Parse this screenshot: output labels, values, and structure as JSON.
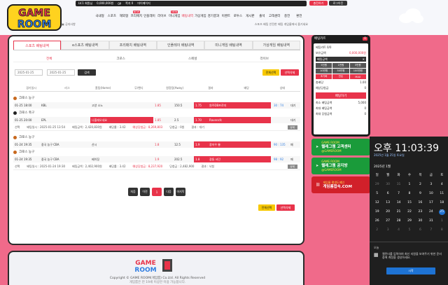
{
  "header": {
    "topbar": [
      "LV.1 회원님",
      "0,000,000원",
      "0P",
      "쪽지 0",
      "마이페이지"
    ],
    "top_buttons": [
      "충전하기",
      "로그아웃"
    ],
    "nav": [
      {
        "label": "국내형",
        "badge": ""
      },
      {
        "label": "스포츠",
        "badge": ""
      },
      {
        "label": "해외형",
        "badge": ""
      },
      {
        "label": "프리매치",
        "badge": "NEW"
      },
      {
        "label": "인플레이",
        "badge": ""
      },
      {
        "label": "라이브",
        "badge": ""
      },
      {
        "label": "미니게임",
        "badge": "NEW"
      },
      {
        "label": "배팅내역",
        "badge": ""
      },
      {
        "label": "가상게임",
        "badge": ""
      },
      {
        "label": "경기결과",
        "badge": ""
      },
      {
        "label": "이벤트",
        "badge": ""
      },
      {
        "label": "로투스",
        "badge": ""
      },
      {
        "label": "게시판",
        "badge": ""
      },
      {
        "label": "출석",
        "badge": ""
      },
      {
        "label": "고객센터",
        "badge": ""
      },
      {
        "label": "충전",
        "badge": ""
      },
      {
        "label": "환전",
        "badge": ""
      }
    ],
    "notice": "공지사항",
    "subbar_right": "스포츠 배팅 안전한 배팅 게임룸에서 즐기세요"
  },
  "logo_text": "GAME ROOM",
  "tabs": [
    "스포츠 배팅내역",
    "e스포츠 배팅내역",
    "프리매치 배팅내역",
    "인플레이 배팅내역",
    "미니게임 배팅내역",
    "가상게임 배팅내역"
  ],
  "subtabs": [
    "전체",
    "크로스",
    "스페셜",
    "라이브"
  ],
  "filter": {
    "date_from": "2025-01-25",
    "date_to": "2025-01-25",
    "search": "검색",
    "select_all": "전체선택",
    "delete_sel": "선택삭제"
  },
  "columns": [
    "경기일시",
    "리그",
    "홈팀(Home)",
    "무/핸디",
    "원정팀(Away)",
    "결과",
    "배당",
    "상태"
  ],
  "bets": [
    {
      "rows": [
        {
          "league": "크로스 농구",
          "time": "01-25 18:00",
          "flag": "KBL",
          "home": "고양 소노",
          "mark": "1.85",
          "handi": "150.5",
          "away_odds": "1.75",
          "away": "원주DB프로미",
          "score": "30 : 74",
          "status": "대기"
        },
        {
          "league": "크로스 축구",
          "time": "01-25 20:00",
          "flag": "EPL",
          "home": "나폴레오네요",
          "mark": "1.85",
          "handi": "2.5",
          "away_odds": "1.70",
          "away": "Ravensfc",
          "score": "",
          "status": "대기"
        }
      ],
      "info": {
        "check": "선택",
        "date": "배팅일시 : 2025-01-25 13:54",
        "amount": "배팅금액 : 2,420,830원",
        "odds": "배당률 : 3.42",
        "expected": "예상당첨금 : 8,269,803",
        "win": "당첨금 : 0원",
        "result": "결과 : 대기",
        "detail": "상세"
      }
    },
    {
      "rows": [
        {
          "league": "크로스 농구",
          "time": "01-24 19:35",
          "flag": "중국 농구 CBA",
          "home": "산시",
          "mark": "1.8",
          "handi": "12.5",
          "away_odds": "1.9",
          "away": "광저우 롱",
          "score": "90 : 135",
          "status": "패"
        },
        {
          "league": "크로스 농구",
          "time": "01-24 19:35",
          "flag": "중국 농구 CBA",
          "home": "베이징",
          "mark": "1.9",
          "handi": "202.5",
          "away_odds": "1.8",
          "away": "광둥 서던",
          "score": "98 : 92",
          "status": "패"
        }
      ],
      "info": {
        "check": "선택",
        "date": "배팅일시 : 2025-01-24 19:30",
        "amount": "배팅금액 : 2,402,900원",
        "odds": "배당률 : 3.42",
        "expected": "예상당첨금 : 8,237,920",
        "win": "당첨금 : 2,482,900",
        "result": "결과 : 낙첨",
        "detail": "상세"
      }
    }
  ],
  "pager": [
    "처음",
    "이전",
    "1",
    "다음",
    "마지막"
  ],
  "bottom_buttons": [
    "전체선택",
    "선택삭제"
  ],
  "footer": {
    "copyright": "Copyright © GAME ROOM(게임룸) Co.Ltd. All Rights Reserved",
    "sub": "게임룸은 만 19세 이상만 이용 가능합니다."
  },
  "slip": {
    "title": "배팅카트",
    "count": "0",
    "user": "베팅카트 0/0",
    "balance_label": "보유금액",
    "balance": "0,000,000원",
    "section": "배팅금액",
    "amounts": [
      "5천원",
      "1만원",
      "5만원",
      "10만원",
      "50만원",
      "100만원",
      "초기화",
      "잔돈",
      "MAX"
    ],
    "odds_label": "총배당",
    "odds": "1.00",
    "win_label": "예상당첨금",
    "win": "0",
    "bet_button": "배팅하기",
    "limits": [
      {
        "label": "최소 배팅금액",
        "value": "5,000"
      },
      {
        "label": "최대 배팅금액",
        "value": "0"
      },
      {
        "label": "최대 당첨금액",
        "value": "0"
      }
    ]
  },
  "banners": [
    {
      "top": "GAME ROOM",
      "main": "텔레그램 고객센터",
      "sub": "@GAMEROOM",
      "color": "#1a9b3a"
    },
    {
      "top": "GAME ROOM",
      "main": "텔레그램 공지방",
      "sub": "@GAMEROOM",
      "color": "#1a9b3a"
    },
    {
      "top": "게임룸 평생도메인",
      "main": "게임룸접속.COM",
      "sub": "",
      "color": "#d1202a"
    }
  ],
  "flyout": {
    "time": "오후 11:03:39",
    "date": "2025년 1월 25일 토요일",
    "month": "2025년 1월",
    "weekdays": [
      "일",
      "월",
      "화",
      "수",
      "목",
      "금",
      "토"
    ],
    "today": "25",
    "event_title": "오늘",
    "event_text": "캘린더를 입력하여 최신 지원을 보여주기 위한 준비 중에 계정을 생성하세요.",
    "event_button": "시작"
  }
}
